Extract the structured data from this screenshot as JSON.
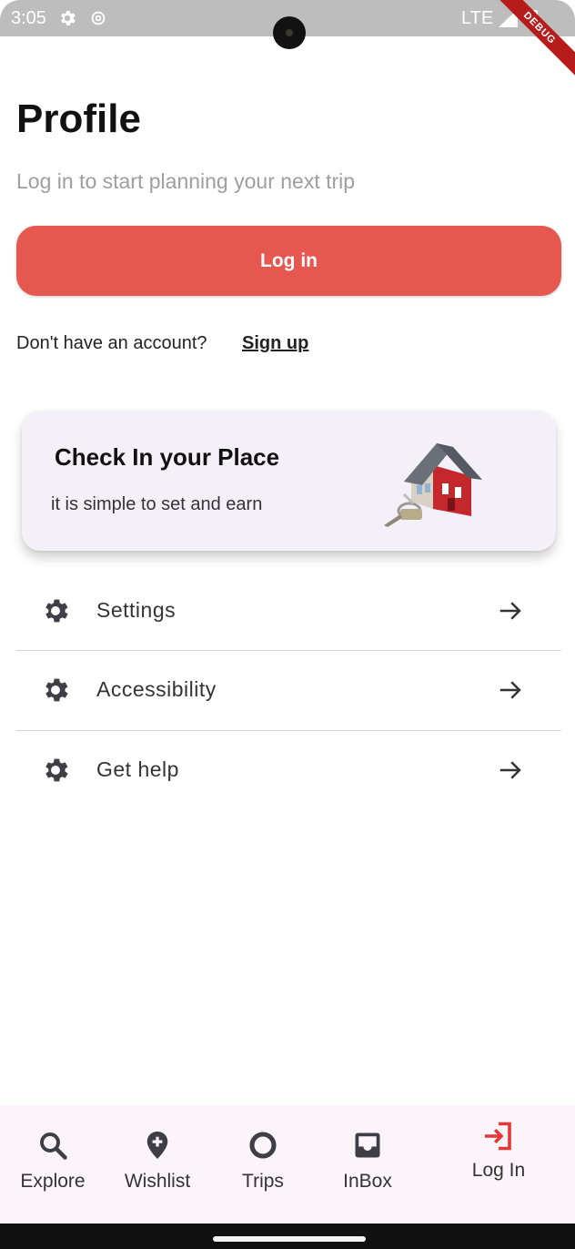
{
  "status_bar": {
    "time": "3:05",
    "network": "LTE",
    "debug_label": "DEBUG"
  },
  "header": {
    "title": "Profile",
    "subtitle": "Log in to start planning your next trip"
  },
  "login_button": {
    "label": "Log in"
  },
  "signup": {
    "prompt": "Don't have an account?",
    "link": "Sign up"
  },
  "promo_card": {
    "title": "Check In your Place",
    "subtitle": "it is simple to set and earn",
    "image": "house-with-keys-image"
  },
  "menu": {
    "items": [
      {
        "label": "Settings",
        "icon": "gear-icon"
      },
      {
        "label": "Accessibility",
        "icon": "gear-icon"
      },
      {
        "label": "Get help",
        "icon": "gear-icon"
      }
    ]
  },
  "bottom_nav": {
    "items": [
      {
        "label": "Explore",
        "icon": "search-icon"
      },
      {
        "label": "Wishlist",
        "icon": "location-plus-icon"
      },
      {
        "label": "Trips",
        "icon": "ring-icon"
      },
      {
        "label": "InBox",
        "icon": "inbox-icon"
      },
      {
        "label": "Log In",
        "icon": "login-icon",
        "active": true
      }
    ]
  },
  "colors": {
    "accent": "#e5574f",
    "login_nav": "#e53935",
    "card_bg": "#f4f0f8",
    "nav_bg": "#fcf4fb"
  }
}
